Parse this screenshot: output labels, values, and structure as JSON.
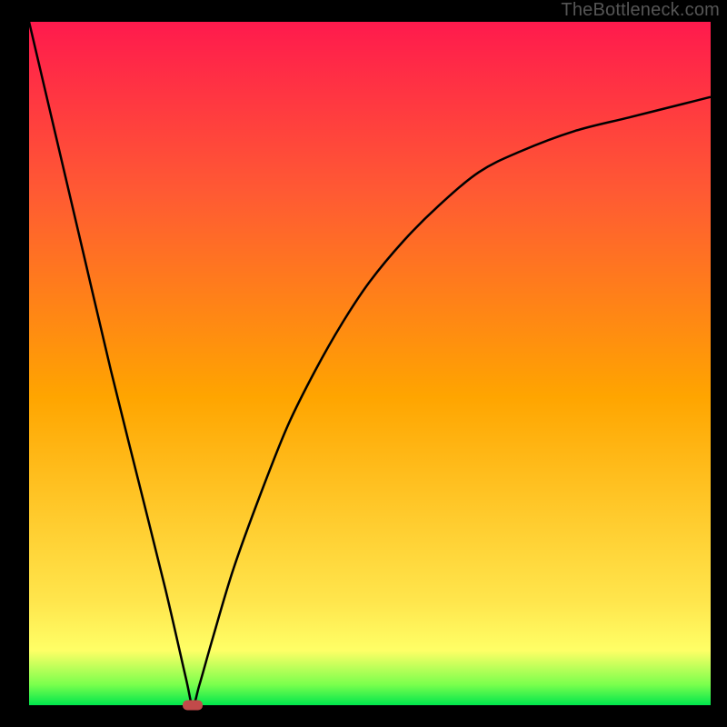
{
  "attribution": "TheBottleneck.com",
  "chart_data": {
    "type": "line",
    "title": "",
    "xlabel": "",
    "ylabel": "",
    "xlim": [
      0,
      100
    ],
    "ylim": [
      0,
      100
    ],
    "grid": false,
    "legend": false,
    "background_gradient": [
      {
        "stop": 0.0,
        "color": "#00e64d"
      },
      {
        "stop": 0.03,
        "color": "#7aff4d"
      },
      {
        "stop": 0.08,
        "color": "#ffff66"
      },
      {
        "stop": 0.15,
        "color": "#ffe64d"
      },
      {
        "stop": 0.45,
        "color": "#ffa500"
      },
      {
        "stop": 0.75,
        "color": "#ff5a33"
      },
      {
        "stop": 1.0,
        "color": "#ff1a4d"
      }
    ],
    "marker": {
      "x": 24,
      "y": 0,
      "color": "#c24a4a"
    },
    "series": [
      {
        "name": "curve",
        "x": [
          0,
          4,
          8,
          12,
          16,
          20,
          23,
          24,
          25,
          27,
          30,
          34,
          38,
          42,
          46,
          50,
          55,
          60,
          66,
          72,
          80,
          88,
          96,
          100
        ],
        "y": [
          100,
          83,
          66,
          49,
          33,
          17,
          4,
          0,
          3,
          10,
          20,
          31,
          41,
          49,
          56,
          62,
          68,
          73,
          78,
          81,
          84,
          86,
          88,
          89
        ]
      }
    ]
  }
}
